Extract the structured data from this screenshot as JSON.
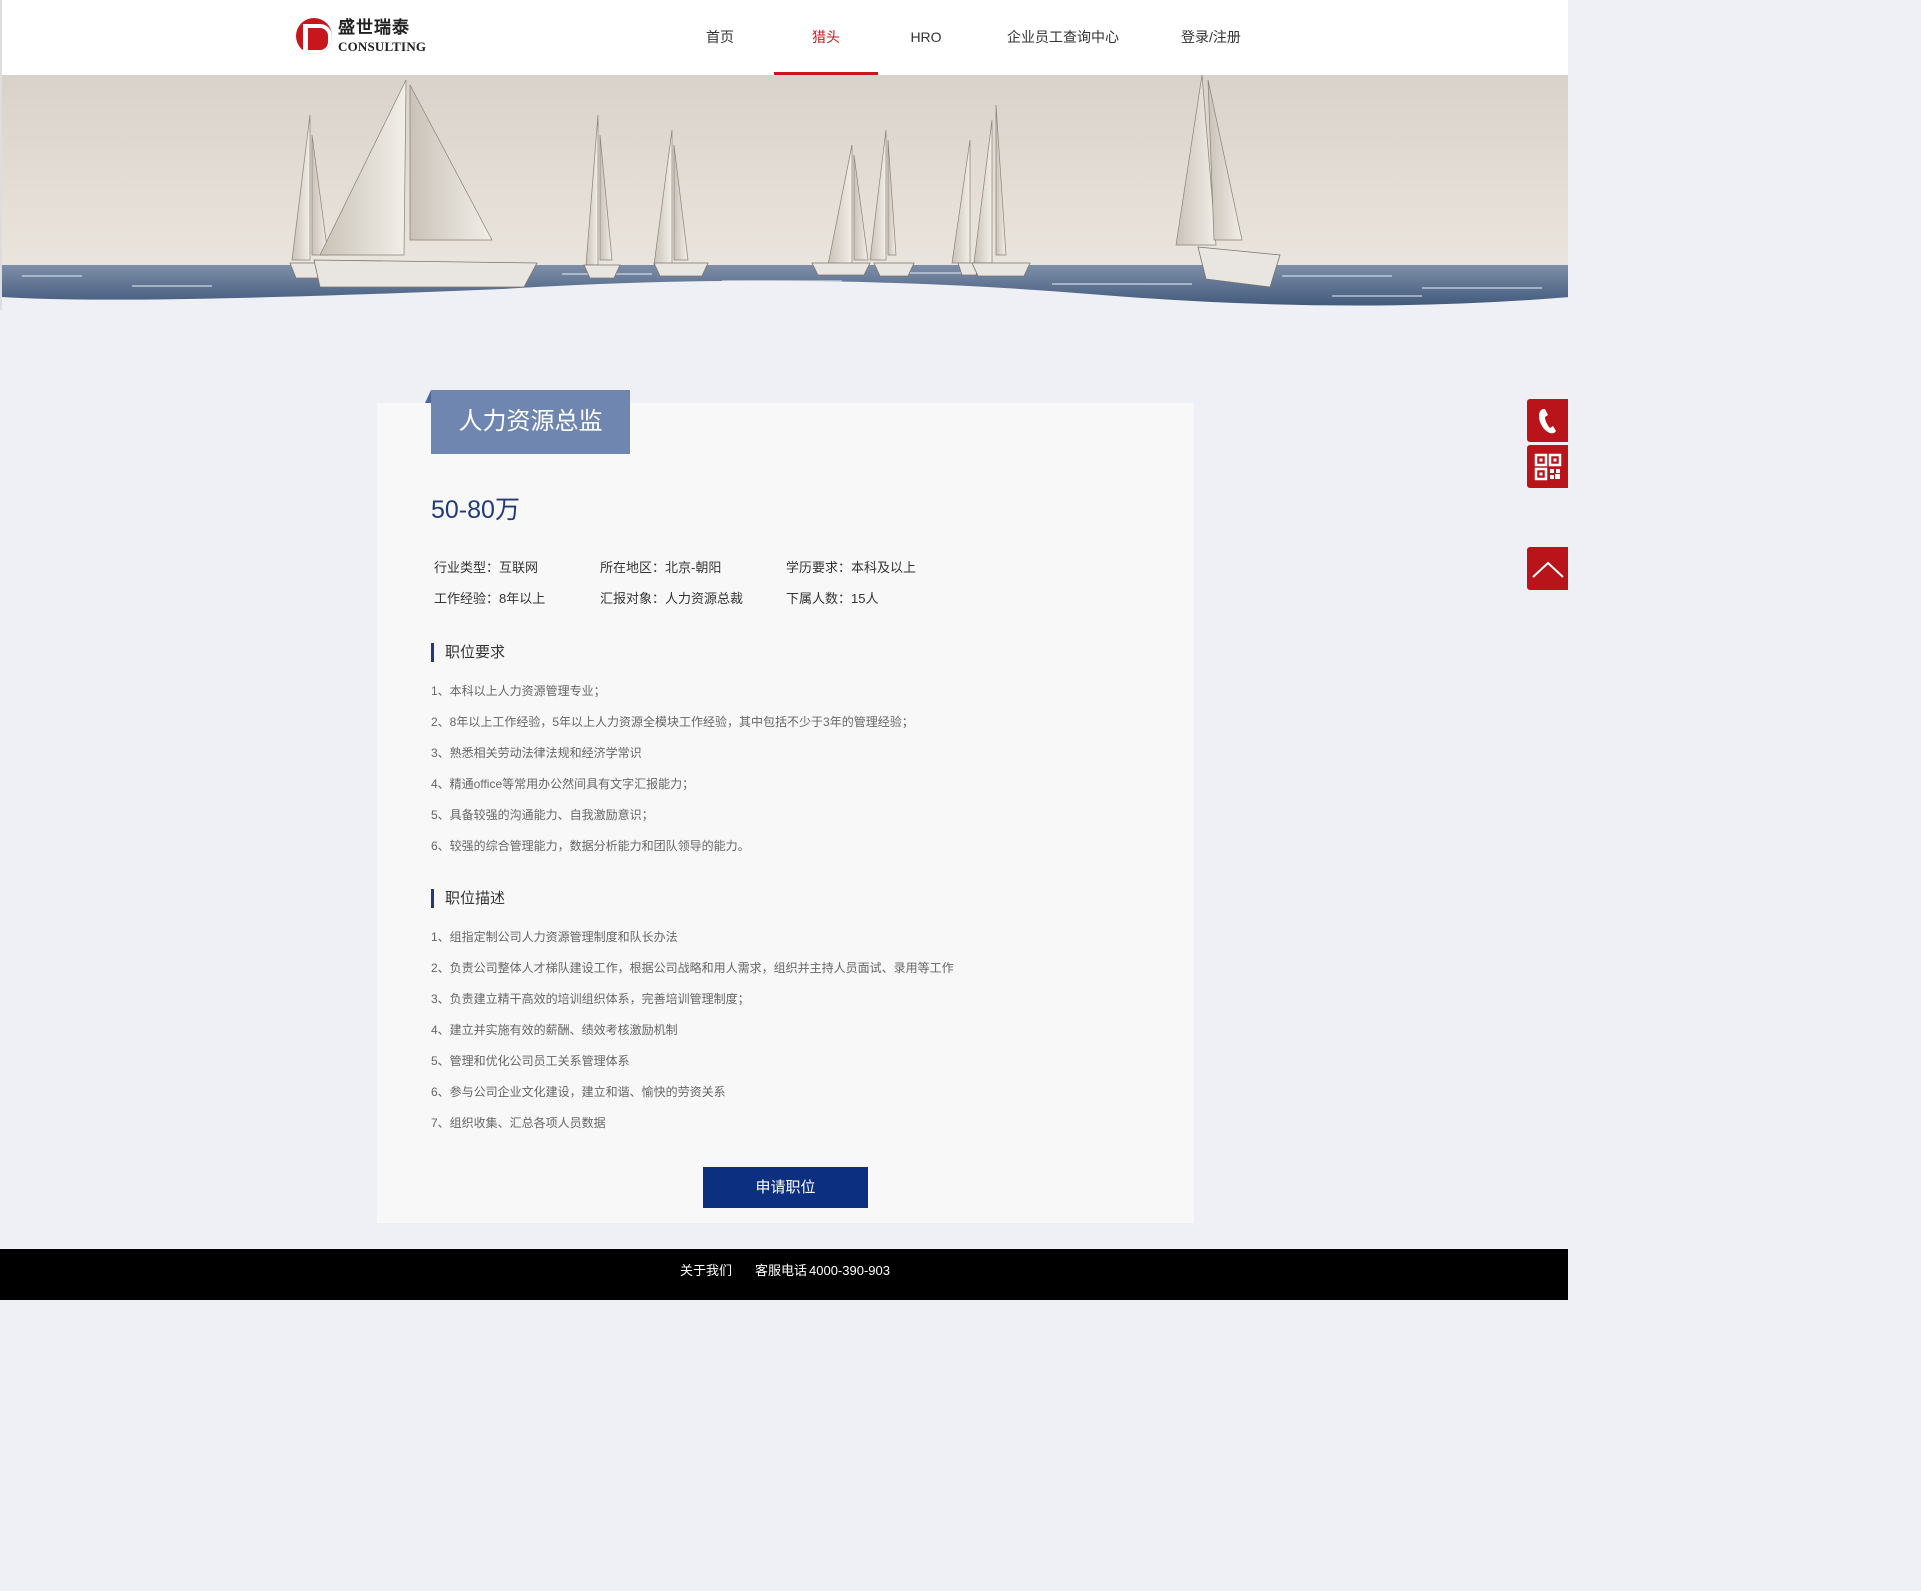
{
  "brand": {
    "name_cn": "盛世瑞泰",
    "name_en": "CONSULTING"
  },
  "nav": {
    "items": [
      {
        "label": "首页"
      },
      {
        "label": "猎头",
        "active": true
      },
      {
        "label": "HRO"
      },
      {
        "label": "企业员工查询中心"
      },
      {
        "label": "登录/注册"
      }
    ],
    "active_color": "#c8161d"
  },
  "job": {
    "title": "人力资源总监",
    "salary": "50-80万",
    "info": {
      "industry": "行业类型：互联网",
      "location": "所在地区：北京-朝阳",
      "education": "学历要求：本科及以上",
      "experience": "工作经验：8年以上",
      "report_to": "汇报对象：人力资源总裁",
      "subordinates": "下属人数：15人"
    },
    "requirements_title": "职位要求",
    "requirements": [
      "1、本科以上人力资源管理专业；",
      "2、8年以上工作经验，5年以上人力资源全模块工作经验，其中包括不少于3年的管理经验；",
      "3、熟悉相关劳动法律法规和经济学常识",
      "4、精通office等常用办公然间具有文字汇报能力；",
      "5、具备较强的沟通能力、自我激励意识；",
      "6、较强的综合管理能力，数据分析能力和团队领导的能力。"
    ],
    "description_title": "职位描述",
    "description": [
      "1、组指定制公司人力资源管理制度和队长办法",
      "2、负责公司整体人才梯队建设工作，根据公司战略和用人需求，组织并主持人员面试、录用等工作",
      "3、负责建立精干高效的培训组织体系，完善培训管理制度；",
      "4、建立并实施有效的薪酬、绩效考核激励机制",
      "5、管理和优化公司员工关系管理体系",
      "6、参与公司企业文化建设，建立和谐、愉快的劳资关系",
      "7、组织收集、汇总各项人员数据"
    ],
    "apply_label": "申请职位"
  },
  "side": {
    "phone_icon": "phone-icon",
    "qr_icon": "qr-code-icon",
    "top_icon": "back-to-top-icon"
  },
  "footer": {
    "about": "关于我们",
    "phone_label": "客服电话",
    "phone_number": "4000-390-903"
  },
  "colors": {
    "brand_red": "#c8161d",
    "navy": "#0d2f7f",
    "tab_blue": "#6f87b0",
    "background": "#eff0f5"
  }
}
